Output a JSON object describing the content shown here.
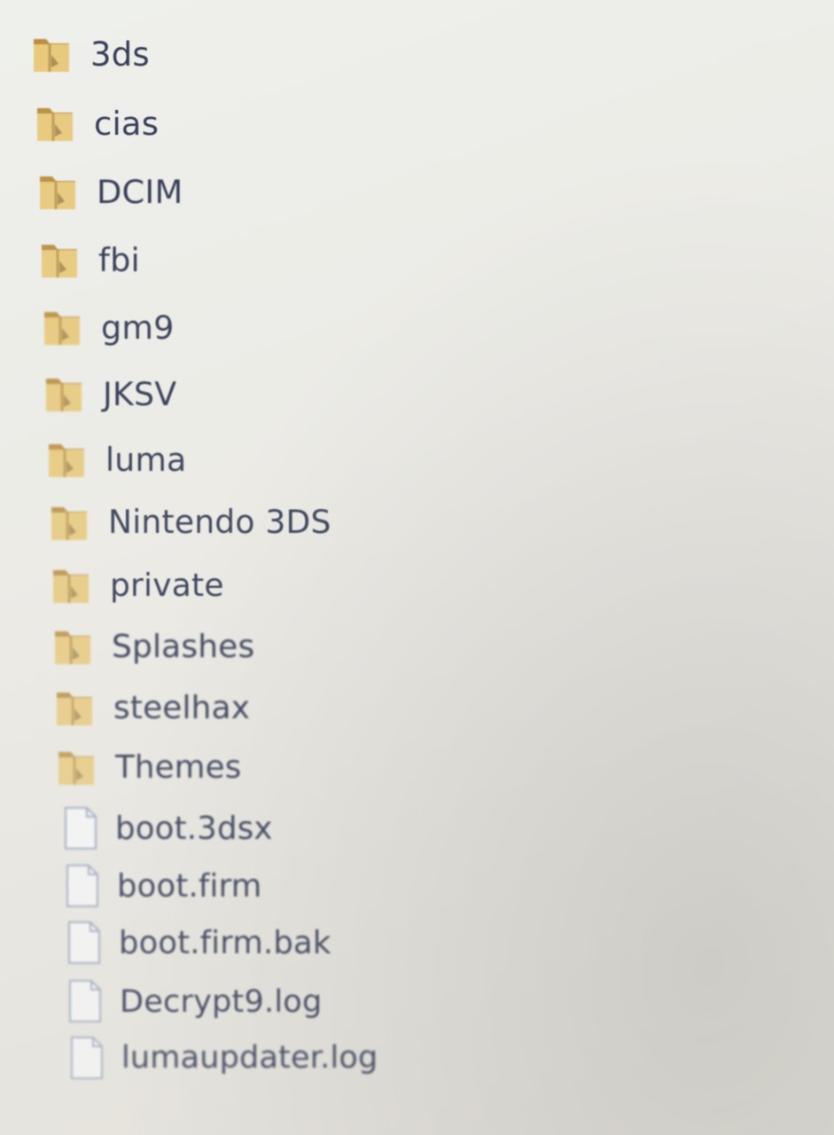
{
  "explorer": {
    "colors": {
      "folder_tab": "#b88a3a",
      "folder_front": "#e8c878",
      "file_border": "#8c9bb8",
      "label_text": "#2c3550"
    },
    "items": [
      {
        "name": "3ds",
        "type": "folder",
        "icon": "folder-icon"
      },
      {
        "name": "cias",
        "type": "folder",
        "icon": "folder-icon"
      },
      {
        "name": "DCIM",
        "type": "folder",
        "icon": "folder-icon"
      },
      {
        "name": "fbi",
        "type": "folder",
        "icon": "folder-icon"
      },
      {
        "name": "gm9",
        "type": "folder",
        "icon": "folder-icon"
      },
      {
        "name": "JKSV",
        "type": "folder",
        "icon": "folder-icon"
      },
      {
        "name": "luma",
        "type": "folder",
        "icon": "folder-icon"
      },
      {
        "name": "Nintendo 3DS",
        "type": "folder",
        "icon": "folder-icon"
      },
      {
        "name": "private",
        "type": "folder",
        "icon": "folder-icon"
      },
      {
        "name": "Splashes",
        "type": "folder",
        "icon": "folder-icon"
      },
      {
        "name": "steelhax",
        "type": "folder",
        "icon": "folder-icon"
      },
      {
        "name": "Themes",
        "type": "folder",
        "icon": "folder-icon"
      },
      {
        "name": "boot.3dsx",
        "type": "file",
        "icon": "file-icon"
      },
      {
        "name": "boot.firm",
        "type": "file",
        "icon": "file-icon"
      },
      {
        "name": "boot.firm.bak",
        "type": "file",
        "icon": "file-icon"
      },
      {
        "name": "Decrypt9.log",
        "type": "file",
        "icon": "file-icon"
      },
      {
        "name": "lumaupdater.log",
        "type": "file",
        "icon": "file-icon"
      }
    ]
  }
}
